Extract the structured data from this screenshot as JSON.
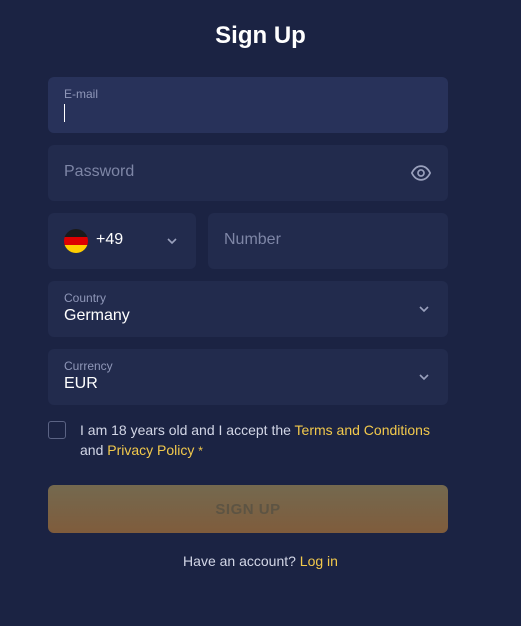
{
  "title": "Sign Up",
  "email": {
    "label": "E-mail",
    "value": ""
  },
  "password": {
    "placeholder": "Password"
  },
  "phone": {
    "code": "+49",
    "placeholder": "Number",
    "flag": "germany-flag-icon"
  },
  "country": {
    "label": "Country",
    "value": "Germany"
  },
  "currency": {
    "label": "Currency",
    "value": "EUR"
  },
  "terms": {
    "text_before": "I am 18 years old and I accept the ",
    "terms_link": "Terms and Conditions",
    "and": "and ",
    "privacy_link": "Privacy Policy",
    "required_mark": "*"
  },
  "signup_button": "SIGN UP",
  "footer": {
    "text": "Have an account? ",
    "login_link": "Log in"
  },
  "colors": {
    "background": "#1b2343",
    "field": "#222b4d",
    "accent": "#f2c94c"
  }
}
